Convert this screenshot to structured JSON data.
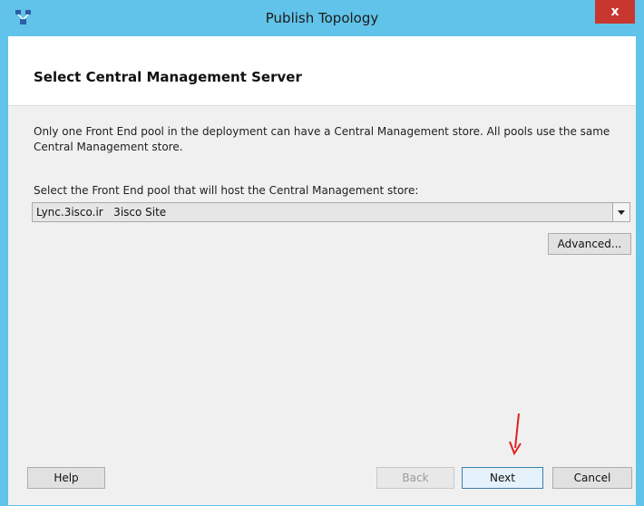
{
  "window": {
    "title": "Publish Topology",
    "close_glyph": "x"
  },
  "page": {
    "title": "Select Central Management Server",
    "description": "Only one Front End pool in the deployment can have a Central Management store. All pools use the same Central Management store.",
    "select_label": "Select the Front End pool that will host the Central Management store:"
  },
  "pool_select": {
    "selected": "Lync.3isco.ir   3isco Site"
  },
  "buttons": {
    "advanced": "Advanced...",
    "help": "Help",
    "back": "Back",
    "next": "Next",
    "cancel": "Cancel"
  },
  "colors": {
    "titlebar": "#61c3e9",
    "close": "#c7372f",
    "annotation_arrow": "#e02020"
  },
  "icons": {
    "app": "topology-icon",
    "dropdown": "chevron-down-icon",
    "annotation": "red-arrow-annotation"
  }
}
